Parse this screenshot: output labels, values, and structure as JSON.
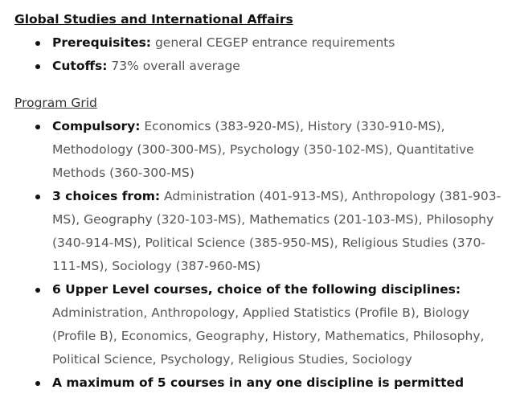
{
  "section_title": "Global Studies and International Affairs",
  "admission": [
    {
      "label": "Prerequisites:",
      "text": " general CEGEP entrance requirements"
    },
    {
      "label": "Cutoffs:",
      "text": " 73% overall average"
    }
  ],
  "program_grid_title": "Program Grid",
  "program_grid": [
    {
      "label": "Compulsory:",
      "text": " Economics (383-920-MS), History (330-910-MS), Methodology (300-300-MS), Psychology (350-102-MS), Quantitative Methods (360-300-MS)"
    },
    {
      "label": "3 choices from:",
      "text": " Administration (401-913-MS), Anthropology (381-903-MS), Geography (320-103-MS), Mathematics (201-103-MS), Philosophy (340-914-MS), Political Science (385-950-MS), Religious Studies (370-111-MS), Sociology (387-960-MS)"
    },
    {
      "label": "6 Upper Level courses, choice of the following disciplines:",
      "text": " Administration, Anthropology, Applied Statistics (Profile B), Biology (Profile B), Economics, Geography, History, Mathematics, Philosophy, Political Science, Psychology, Religious Studies, Sociology"
    },
    {
      "label": "A maximum of 5 courses in any one discipline is permitted",
      "text": ""
    }
  ]
}
